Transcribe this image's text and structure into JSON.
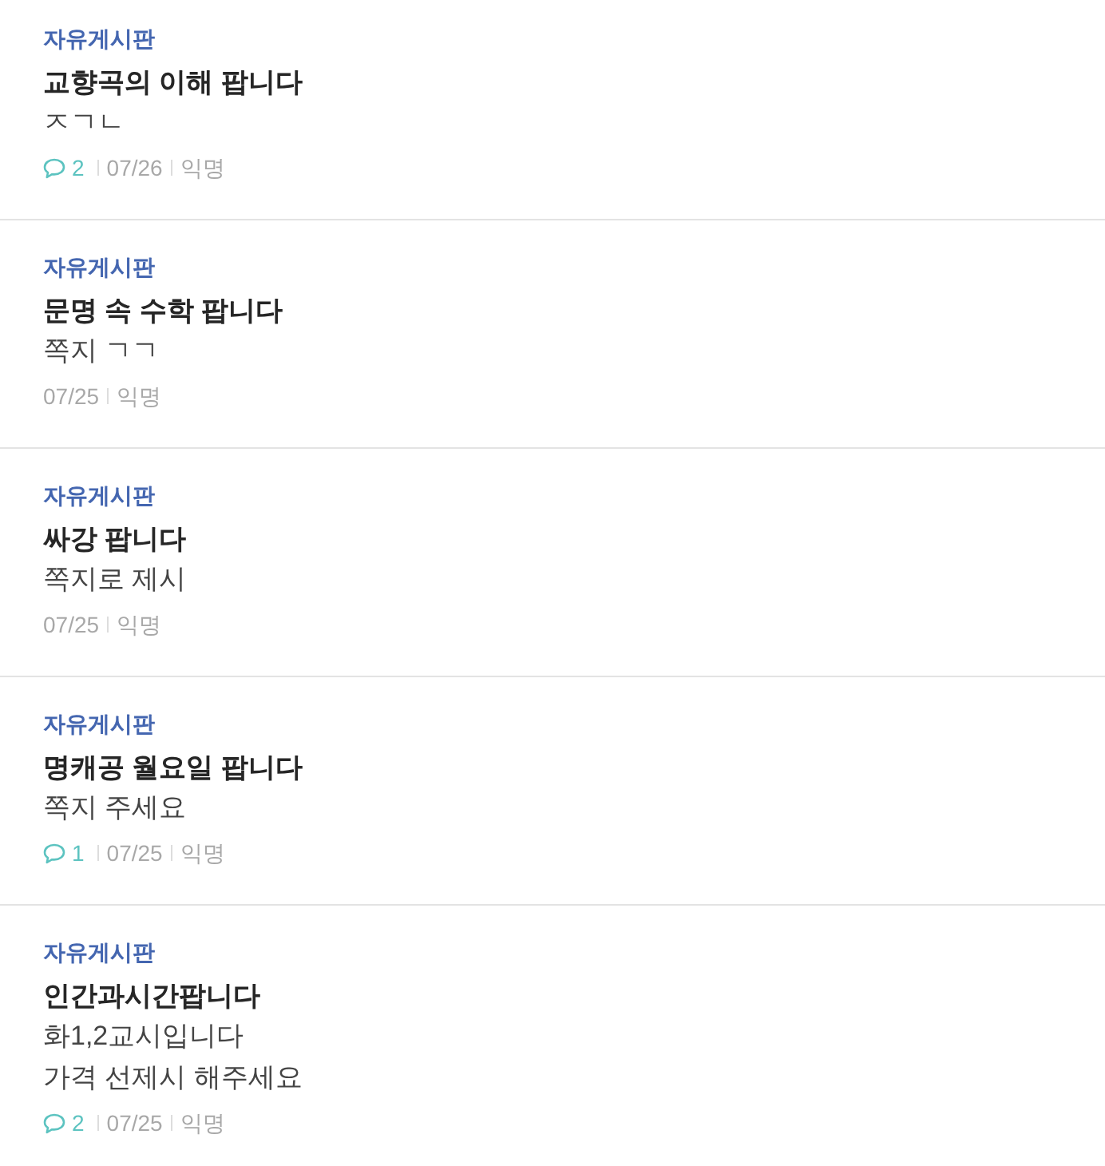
{
  "posts": [
    {
      "board": "자유게시판",
      "title": "교향곡의 이해 팝니다",
      "body": "ㅈㄱㄴ",
      "comments": "2",
      "date": "07/26",
      "author": "익명"
    },
    {
      "board": "자유게시판",
      "title": "문명 속 수학 팝니다",
      "body": "쪽지 ㄱㄱ",
      "date": "07/25",
      "author": "익명"
    },
    {
      "board": "자유게시판",
      "title": "싸강 팝니다",
      "body": "쪽지로 제시",
      "date": "07/25",
      "author": "익명"
    },
    {
      "board": "자유게시판",
      "title": "명캐공 월요일 팝니다",
      "body": "쪽지 주세요",
      "comments": "1",
      "date": "07/25",
      "author": "익명"
    },
    {
      "board": "자유게시판",
      "title": "인간과시간팝니다",
      "body": "화1,2교시입니다\n가격 선제시 해주세요",
      "comments": "2",
      "date": "07/25",
      "author": "익명"
    }
  ]
}
